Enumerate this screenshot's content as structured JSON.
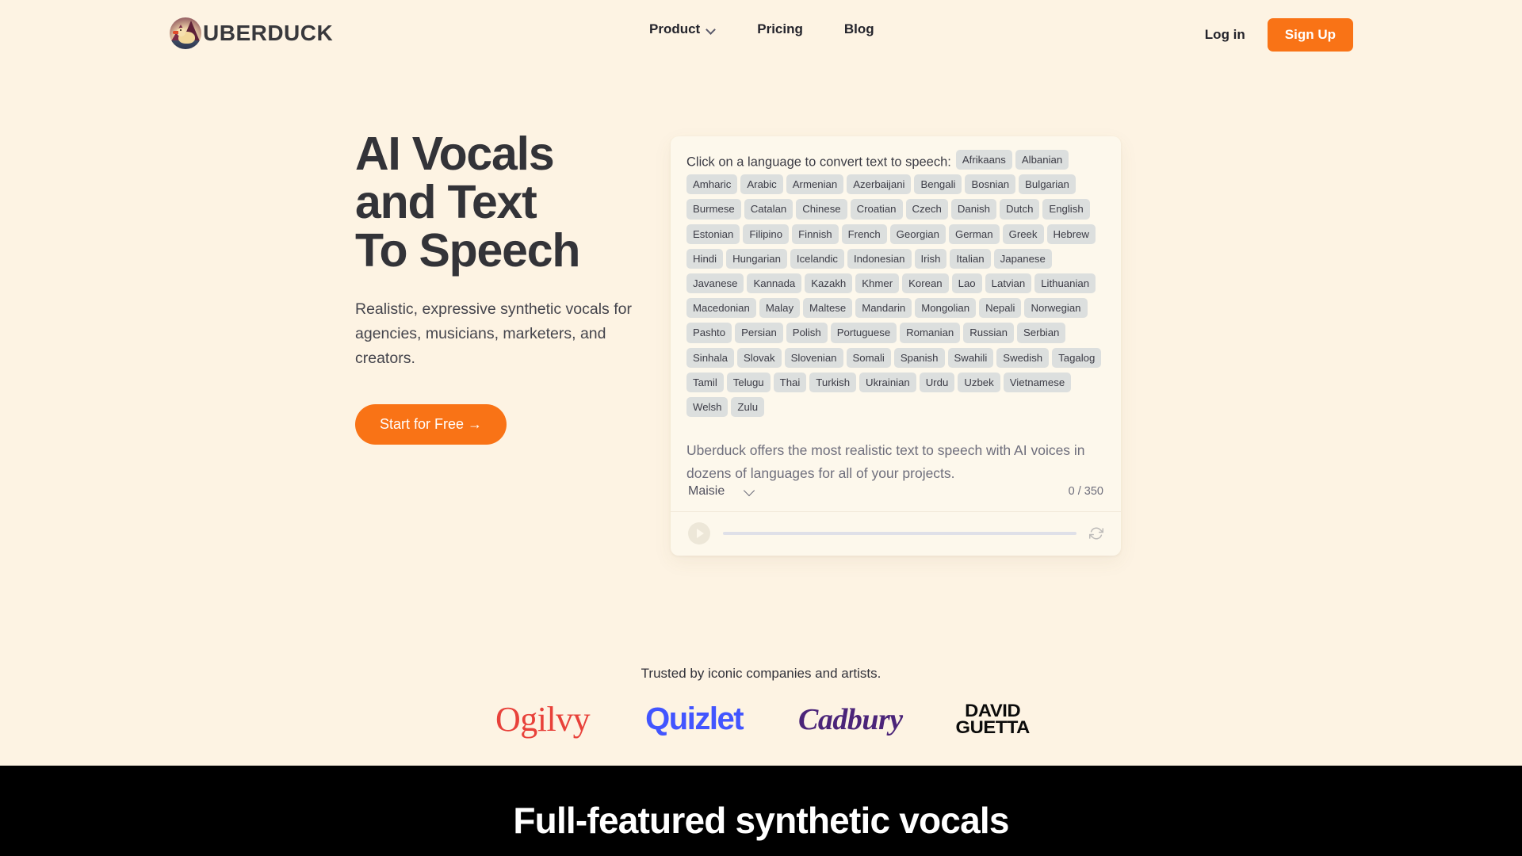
{
  "nav": {
    "brand": "UBERDUCK",
    "links": [
      {
        "label": "Product",
        "has_chevron": true
      },
      {
        "label": "Pricing",
        "has_chevron": false
      },
      {
        "label": "Blog",
        "has_chevron": false
      }
    ],
    "login_label": "Log in",
    "signup_label": "Sign Up",
    "signup_color": "#F97316"
  },
  "hero": {
    "title": "AI Vocals\nand Text\nTo Speech",
    "subtitle": "Realistic, expressive synthetic vocals for agencies, musicians, marketers, and creators.",
    "cta_label": "Start for Free →",
    "cta_color": "#F97316"
  },
  "tts": {
    "prompt": "Click on a language to convert text to speech:",
    "languages": [
      "Afrikaans",
      "Albanian",
      "Amharic",
      "Arabic",
      "Armenian",
      "Azerbaijani",
      "Bengali",
      "Bosnian",
      "Bulgarian",
      "Burmese",
      "Catalan",
      "Chinese",
      "Croatian",
      "Czech",
      "Danish",
      "Dutch",
      "English",
      "Estonian",
      "Filipino",
      "Finnish",
      "French",
      "Georgian",
      "German",
      "Greek",
      "Hebrew",
      "Hindi",
      "Hungarian",
      "Icelandic",
      "Indonesian",
      "Irish",
      "Italian",
      "Japanese",
      "Javanese",
      "Kannada",
      "Kazakh",
      "Khmer",
      "Korean",
      "Lao",
      "Latvian",
      "Lithuanian",
      "Macedonian",
      "Malay",
      "Maltese",
      "Mandarin",
      "Mongolian",
      "Nepali",
      "Norwegian",
      "Pashto",
      "Persian",
      "Polish",
      "Portuguese",
      "Romanian",
      "Russian",
      "Serbian",
      "Sinhala",
      "Slovak",
      "Slovenian",
      "Somali",
      "Spanish",
      "Swahili",
      "Swedish",
      "Tagalog",
      "Tamil",
      "Telugu",
      "Thai",
      "Turkish",
      "Ukrainian",
      "Urdu",
      "Uzbek",
      "Vietnamese",
      "Welsh",
      "Zulu"
    ],
    "textarea_value": "",
    "textarea_placeholder": "Uberduck offers the most realistic text to speech with AI voices in dozens of languages for all of your projects.",
    "voice_selected": "Maisie",
    "char_count": "0 / 350",
    "tag_bg": "#DCDFDE",
    "card_bg": "#FDF8EC"
  },
  "trusted": {
    "heading": "Trusted by iconic companies and artists.",
    "logos": [
      {
        "name": "Ogilvy",
        "text": "Ogilvy",
        "color": "#E8413A"
      },
      {
        "name": "Quizlet",
        "text": "Quizlet",
        "color": "#4255FF"
      },
      {
        "name": "Cadbury",
        "text": "Cadbury",
        "color": "#4B2479"
      },
      {
        "name": "David Guetta",
        "line1": "DAVID",
        "line2": "GUETTA",
        "color": "#0B0B0B"
      }
    ]
  },
  "dark_section": {
    "heading": "Full-featured synthetic vocals",
    "background": "#000000"
  },
  "page": {
    "background": "#FDF3E3"
  }
}
